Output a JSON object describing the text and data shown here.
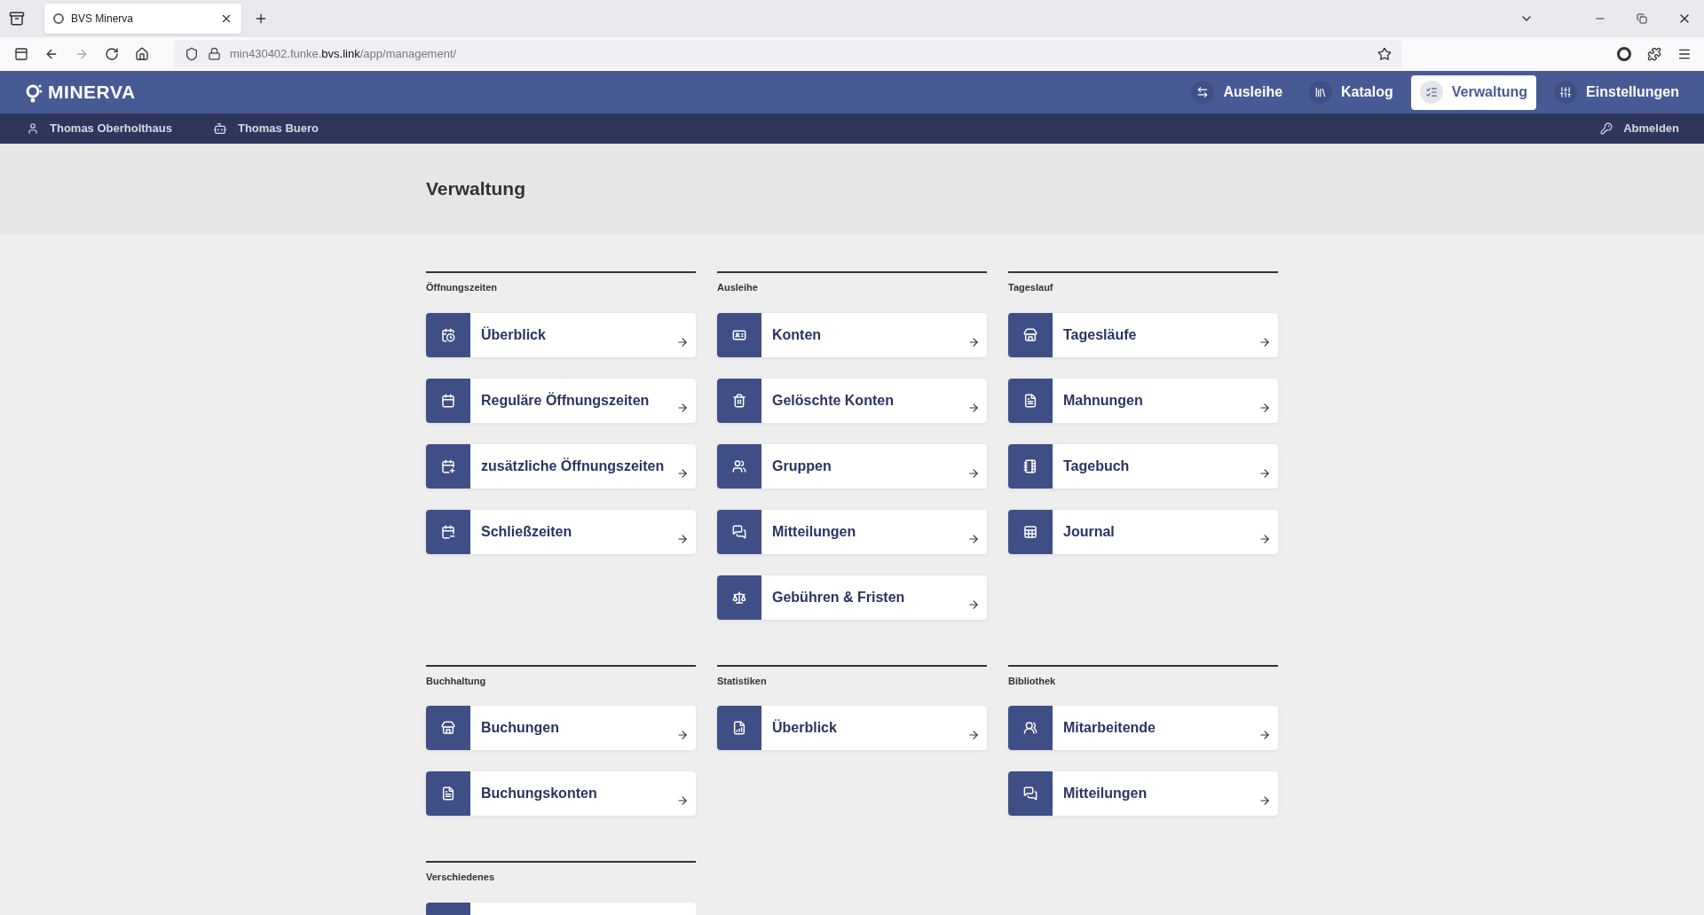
{
  "browser": {
    "tab_title": "BVS Minerva",
    "url_host_prefix": "min430402.funke.",
    "url_host_domain": "bvs.link",
    "url_path": "/app/management/"
  },
  "app": {
    "logo": "MINERVA",
    "nav": [
      {
        "label": "Ausleihe",
        "selected": false
      },
      {
        "label": "Katalog",
        "selected": false
      },
      {
        "label": "Verwaltung",
        "selected": true
      },
      {
        "label": "Einstellungen",
        "selected": false
      }
    ],
    "user": "Thomas Oberholthaus",
    "station": "Thomas Buero",
    "logout": "Abmelden"
  },
  "page_title": "Verwaltung",
  "sections": [
    {
      "title": "Öffnungszeiten",
      "items": [
        {
          "kind": "link",
          "label": "Überblick"
        },
        {
          "kind": "link",
          "label": "Reguläre Öffnungszeiten"
        },
        {
          "kind": "link",
          "label": "zusätzliche Öffnungszeiten"
        },
        {
          "kind": "link",
          "label": "Schließzeiten"
        }
      ]
    },
    {
      "title": "Ausleihe",
      "items": [
        {
          "kind": "link",
          "label": "Konten"
        },
        {
          "kind": "link",
          "label": "Gelöschte Konten"
        },
        {
          "kind": "link",
          "label": "Gruppen"
        },
        {
          "kind": "link",
          "label": "Mitteilungen"
        },
        {
          "kind": "link",
          "label": "Gebühren & Fristen"
        }
      ]
    },
    {
      "title": "Tageslauf",
      "items": [
        {
          "kind": "link",
          "label": "Tagesläufe"
        },
        {
          "kind": "link",
          "label": "Mahnungen"
        },
        {
          "kind": "link",
          "label": "Tagebuch"
        },
        {
          "kind": "link",
          "label": "Journal"
        }
      ]
    },
    {
      "title": "Buchhaltung",
      "items": [
        {
          "kind": "link",
          "label": "Buchungen"
        },
        {
          "kind": "link",
          "label": "Buchungskonten"
        }
      ]
    },
    {
      "title": "Statistiken",
      "items": [
        {
          "kind": "link",
          "label": "Überblick"
        }
      ]
    },
    {
      "title": "Bibliothek",
      "items": [
        {
          "kind": "link",
          "label": "Mitarbeitende"
        },
        {
          "kind": "link",
          "label": "Mitteilungen"
        }
      ]
    },
    {
      "title": "Verschiedenes",
      "items": [
        {
          "kind": "partial"
        }
      ]
    }
  ]
}
